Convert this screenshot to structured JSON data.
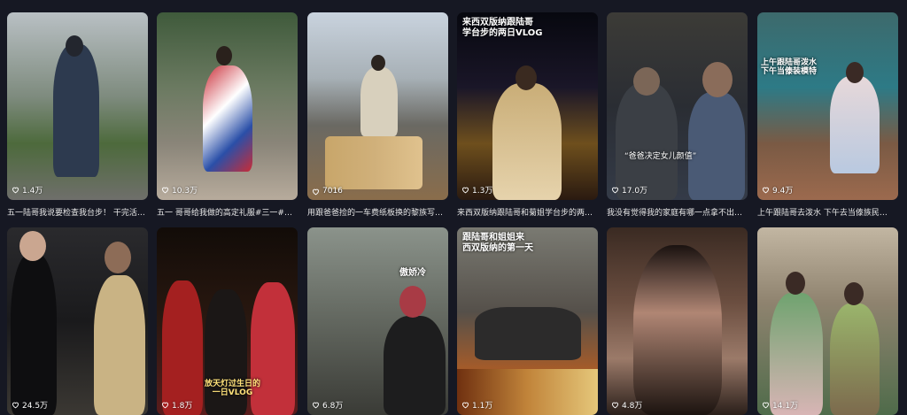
{
  "cards": [
    {
      "likes": "1.4万",
      "caption": "五一陆哥我说要检查我台步！ 干完活…",
      "overlay": "",
      "colors": [
        "#9aa3a8",
        "#4a5a3e"
      ]
    },
    {
      "likes": "10.3万",
      "caption": "五一 哥哥给我做的高定礼服#三一#…",
      "overlay": "",
      "colors": [
        "#5b6b55",
        "#8a8479"
      ]
    },
    {
      "likes": "7016",
      "caption": "用跟爸爸捡的一车费纸板换的黎族写…",
      "overlay": "",
      "colors": [
        "#b7c2cf",
        "#6b6a63"
      ]
    },
    {
      "likes": "1.3万",
      "caption": "来西双版纳跟陆哥和菊姐学台步的两…",
      "overlay": "来西双版纳跟陆哥\n学台步的两日VLOG",
      "colors": [
        "#0d0f1c",
        "#8a6a2d"
      ]
    },
    {
      "likes": "17.0万",
      "caption": "我没有觉得我的家庭有哪一点拿不出…",
      "overlay": "“爸爸决定女儿颜值”",
      "colors": [
        "#2f2f2f",
        "#3b4655"
      ]
    },
    {
      "likes": "9.4万",
      "caption": "上午跟陆哥去泼水 下午去当傣族民…",
      "overlay": "上午跟陆哥泼水\n下午当傣装模特",
      "colors": [
        "#2e5f66",
        "#9c6a4e"
      ]
    },
    {
      "likes": "24.5万",
      "caption": "",
      "overlay": "",
      "colors": [
        "#1b1b1d",
        "#4a4742"
      ]
    },
    {
      "likes": "1.8万",
      "caption": "",
      "overlay": "放天灯过生日的\n一日VLOG",
      "colors": [
        "#1a0f0a",
        "#7a2323"
      ]
    },
    {
      "likes": "6.8万",
      "caption": "",
      "overlay": "傲娇冷",
      "colors": [
        "#7c847c",
        "#3e3f3a"
      ]
    },
    {
      "likes": "1.1万",
      "caption": "",
      "overlay": "跟陆哥和姐姐来\n西双版纳的第一天",
      "colors": [
        "#6d6d67",
        "#a35b2a"
      ]
    },
    {
      "likes": "4.8万",
      "caption": "",
      "overlay": "",
      "colors": [
        "#30241f",
        "#8f6c5e"
      ]
    },
    {
      "likes": "14.1万",
      "caption": "",
      "overlay": "",
      "colors": [
        "#9d8f7b",
        "#4f6b4a"
      ]
    }
  ],
  "icons": {
    "like": "heart-icon"
  }
}
